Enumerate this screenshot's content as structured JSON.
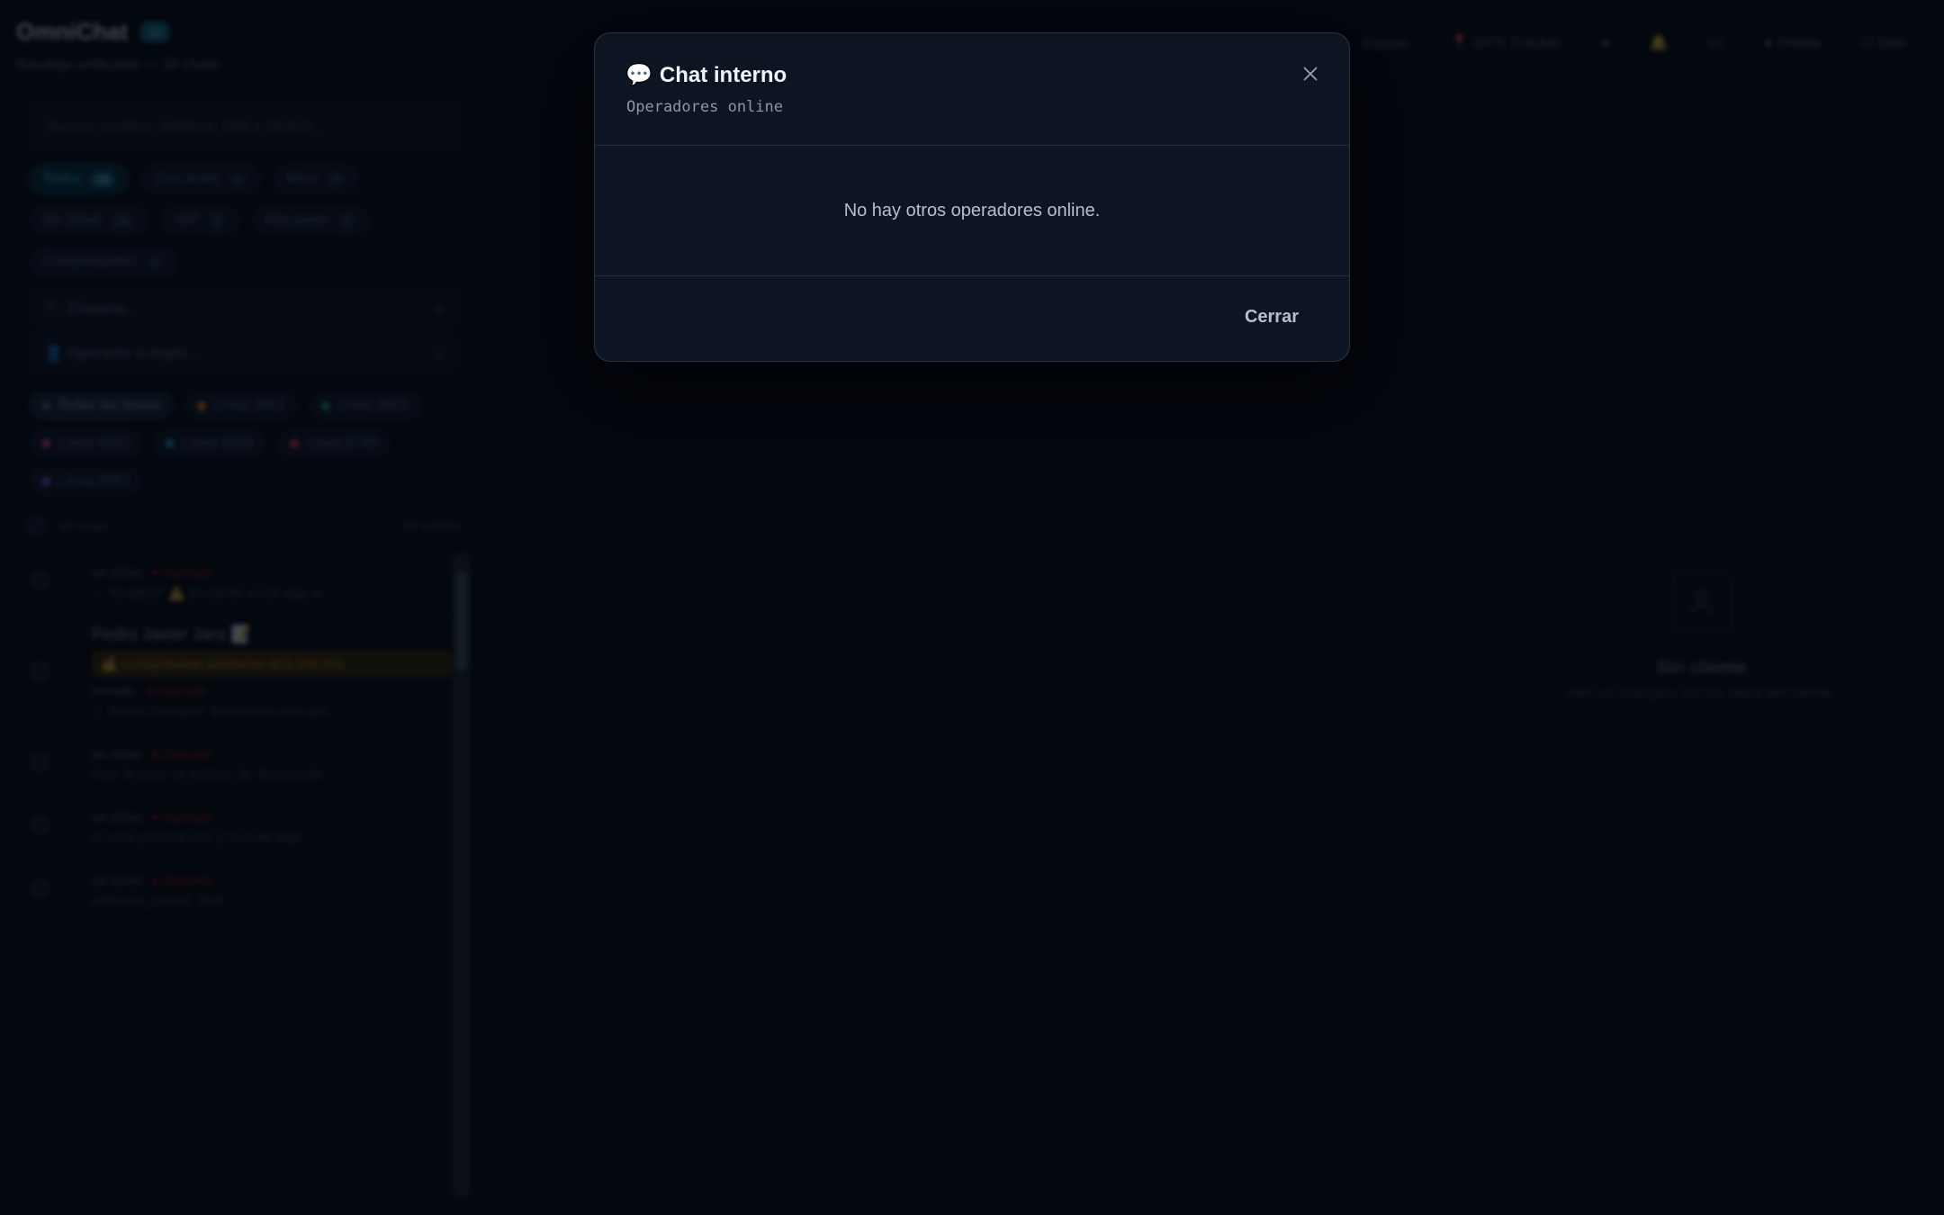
{
  "app": {
    "title": "OmniChat",
    "badge": "v2",
    "subtitle": "Bandeja unificada — 39 chats"
  },
  "sidebar": {
    "search_placeholder": "Buscar nombre, teléfono, DNI o #ticket...",
    "filters": [
      {
        "label": "Todos",
        "count": "39",
        "active": true
      },
      {
        "label": "Con ticket",
        "count": "0"
      },
      {
        "label": "Míos",
        "count": "0"
      },
      {
        "label": "Sin ticket",
        "count": "39"
      },
      {
        "label": "VIP",
        "count": "0"
      },
      {
        "label": "Recupero",
        "count": "0"
      },
      {
        "label": "Comprobantes",
        "count": "1"
      }
    ],
    "tag_select": "🏷 Etiqueta...",
    "operator_select": "👤 Operador o depto...",
    "lines": [
      {
        "label": "Todas las líneas",
        "color": "#64748b",
        "active": true
      },
      {
        "label": "Línea 2661",
        "color": "#f59e0b"
      },
      {
        "label": "Línea 2825",
        "color": "#10b981"
      },
      {
        "label": "Línea 6363",
        "color": "#ec4899"
      },
      {
        "label": "Línea 6645",
        "color": "#06b6d4"
      },
      {
        "label": "Línea 6799",
        "color": "#ef4444"
      },
      {
        "label": "Línea 3567",
        "color": "#8b5cf6"
      }
    ],
    "list_count": "39 chats",
    "list_total": "39 totales",
    "chats": [
      {
        "name": "",
        "tag": "sin ticket",
        "status": "● Expirado",
        "preview": "✓ *Chatbot* ⚠️ El cliente envió algo a..."
      },
      {
        "name": "Pedro Javier Jara 📝",
        "tag": "cerrado",
        "status": "● Expirado",
        "pending": "💰 Comprobante pendiente $15.000 (%)",
        "preview": "✓ *Menú Principal* Selecciona una opc..."
      },
      {
        "name": "",
        "tag": "sin ticket",
        "status": "● Expirado",
        "preview": "Ayer le pase mi número de documento ..."
      },
      {
        "name": "",
        "tag": "sin ticket",
        "status": "● Expirado",
        "preview": "Si mira yo tenía chiz y la di de baja ..."
      },
      {
        "name": "",
        "tag": "sin ticket",
        "status": "● Expirado",
        "preview": "welcome_promo_dtc3"
      }
    ]
  },
  "topnav": {
    "items": [
      "Equipo",
      "📍 GPS Tracker",
      "●",
      "🔔",
      "v1",
      "● Online",
      "⏻ Salir"
    ]
  },
  "client_panel": {
    "title": "Sin cliente",
    "subtitle": "Abrí un chat para ver los datos del cliente."
  },
  "modal": {
    "icon": "💬",
    "title": "Chat interno",
    "subtitle": "Operadores online",
    "empty_message": "No hay otros operadores online.",
    "close_button": "Cerrar"
  },
  "colors": {
    "background": "#05080f",
    "modal_bg": "#0d1422",
    "modal_border": "#283446",
    "accent": "#22d3ee"
  }
}
